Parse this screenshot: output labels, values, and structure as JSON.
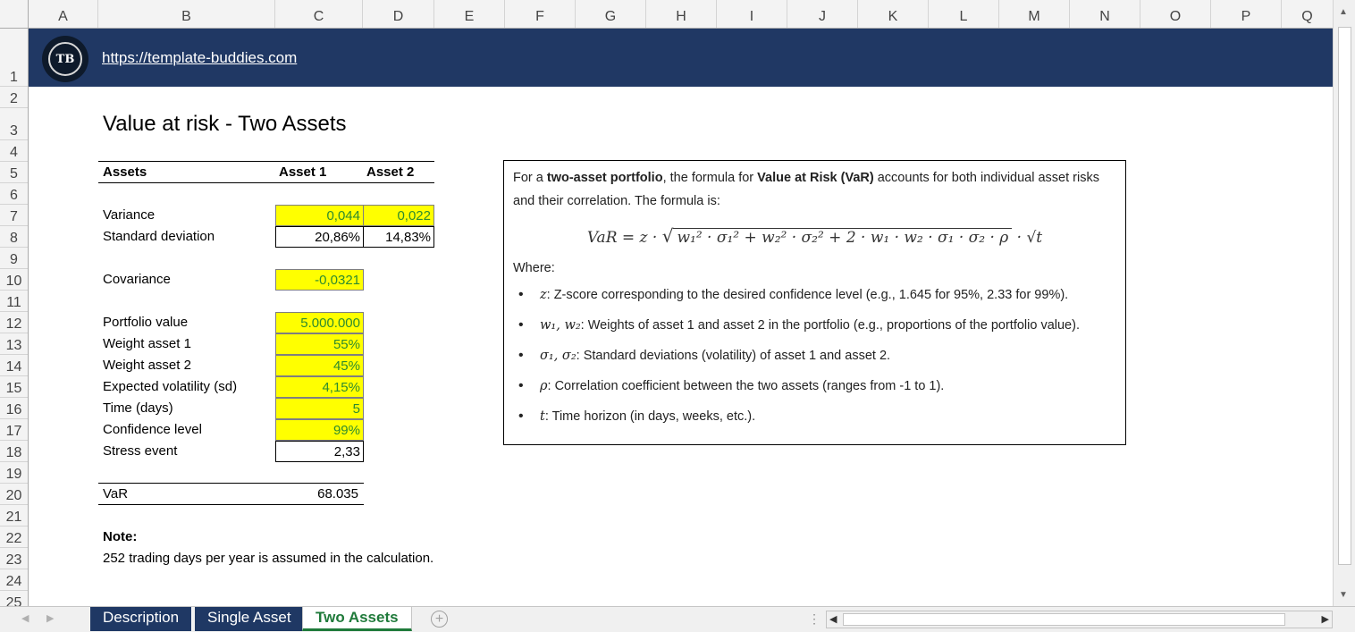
{
  "columns": [
    "A",
    "B",
    "C",
    "D",
    "E",
    "F",
    "G",
    "H",
    "I",
    "J",
    "K",
    "L",
    "M",
    "N",
    "O",
    "P",
    "Q"
  ],
  "rows": [
    "1",
    "2",
    "3",
    "4",
    "5",
    "6",
    "7",
    "8",
    "9",
    "10",
    "11",
    "12",
    "13",
    "14",
    "15",
    "16",
    "17",
    "18",
    "19",
    "20",
    "21",
    "22",
    "23",
    "24",
    "25"
  ],
  "banner": {
    "logo_text": "TB",
    "link": "https://template-buddies.com",
    "color": "#203864"
  },
  "title": "Value at risk - Two Assets",
  "table": {
    "header": {
      "assets": "Assets",
      "asset1": "Asset 1",
      "asset2": "Asset 2"
    },
    "variance": {
      "label": "Variance",
      "asset1": "0,044",
      "asset2": "0,022"
    },
    "std_dev": {
      "label": "Standard deviation",
      "asset1": "20,86%",
      "asset2": "14,83%"
    },
    "covariance": {
      "label": "Covariance",
      "value": "-0,0321"
    },
    "portfolio_value": {
      "label": "Portfolio value",
      "value": "5.000.000"
    },
    "weight1": {
      "label": "Weight asset 1",
      "value": "55%"
    },
    "weight2": {
      "label": "Weight asset 2",
      "value": "45%"
    },
    "volatility": {
      "label": "Expected volatility (sd)",
      "value": "4,15%"
    },
    "time": {
      "label": "Time (days)",
      "value": "5"
    },
    "confidence": {
      "label": "Confidence level",
      "value": "99%"
    },
    "stress": {
      "label": "Stress event",
      "value": "2,33"
    },
    "var": {
      "label": "VaR",
      "value": "68.035"
    }
  },
  "note": {
    "heading": "Note:",
    "text": "252 trading days per year is assumed in the calculation."
  },
  "formula_box": {
    "intro_1": "For a ",
    "intro_bold_1": "two-asset portfolio",
    "intro_2": ", the formula for ",
    "intro_bold_2": "Value at Risk (VaR)",
    "intro_3": " accounts for both individual asset risks and their correlation. The formula is:",
    "formula_lhs": "VaR = z · ",
    "formula_sqrt": "w₁² · σ₁² + w₂² · σ₂² + 2 · w₁ · w₂ · σ₁ · σ₂ · ρ",
    "formula_rhs": " · √t",
    "where": "Where:",
    "bullets": [
      {
        "sym": "z",
        "text": ": Z-score corresponding to the desired confidence level (e.g., 1.645 for 95%, 2.33 for 99%)."
      },
      {
        "sym": "w₁, w₂",
        "text": ": Weights of asset 1 and asset 2 in the portfolio (e.g., proportions of the portfolio value)."
      },
      {
        "sym": "σ₁, σ₂",
        "text": ": Standard deviations (volatility) of asset 1 and asset 2."
      },
      {
        "sym": "ρ",
        "text": ": Correlation coefficient between the two assets (ranges from -1 to 1)."
      },
      {
        "sym": "t",
        "text": ": Time horizon (in days, weeks, etc.)."
      }
    ]
  },
  "tabs": [
    "Description",
    "Single Asset",
    "Two Assets"
  ],
  "active_tab": "Two Assets",
  "colors": {
    "input_fill": "#ffff00",
    "input_text": "#2e8b2e",
    "tab_fill": "#1f3864",
    "active_tab_text": "#1f7a3a"
  },
  "icons": {
    "add_sheet": "plus-circle-icon",
    "scroll_up": "triangle-up-icon",
    "scroll_down": "triangle-down-icon"
  }
}
